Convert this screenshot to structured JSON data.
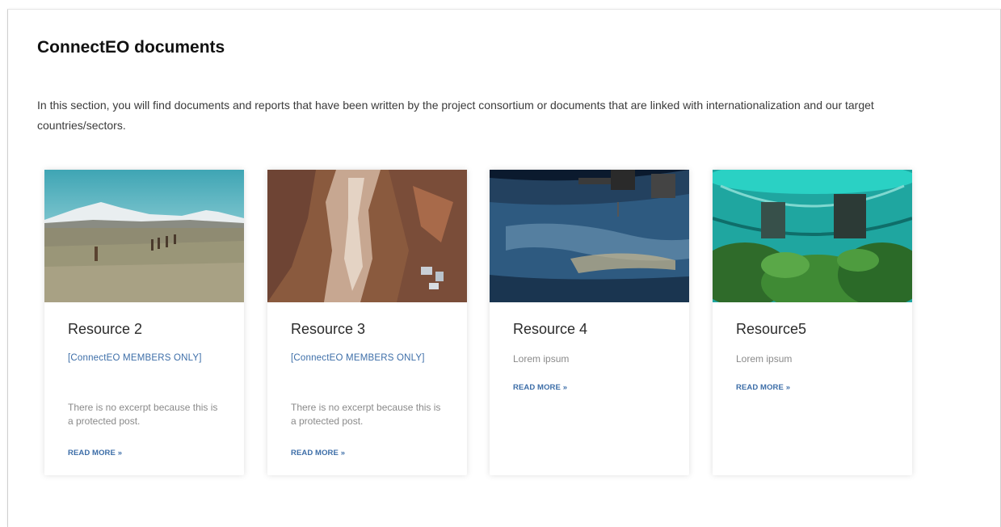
{
  "section": {
    "title": "ConnectEO documents",
    "intro": "In this section, you will find documents and reports that have been written by the project consortium or documents that are linked with internationalization and our target countries/sectors."
  },
  "cards": [
    {
      "title": "Resource 2",
      "members": "[ConnectEO MEMBERS ONLY]",
      "excerpt": "There is no excerpt because this is a protected post.",
      "read_more": "READ MORE »",
      "image": "andes-llamas-landscape"
    },
    {
      "title": "Resource 3",
      "members": "[ConnectEO MEMBERS ONLY]",
      "excerpt": "There is no excerpt because this is a protected post.",
      "read_more": "READ MORE »",
      "image": "desert-satellite-view"
    },
    {
      "title": "Resource 4",
      "excerpt": "Lorem ipsum",
      "read_more": "READ MORE »",
      "image": "earth-from-space-station"
    },
    {
      "title": "Resource5",
      "excerpt": "Lorem ipsum",
      "read_more": "READ MORE »",
      "image": "underwater-habitat-plants"
    }
  ],
  "colors": {
    "link": "#3d6ea8",
    "muted_text": "#8a8a8a",
    "heading": "#111111"
  }
}
